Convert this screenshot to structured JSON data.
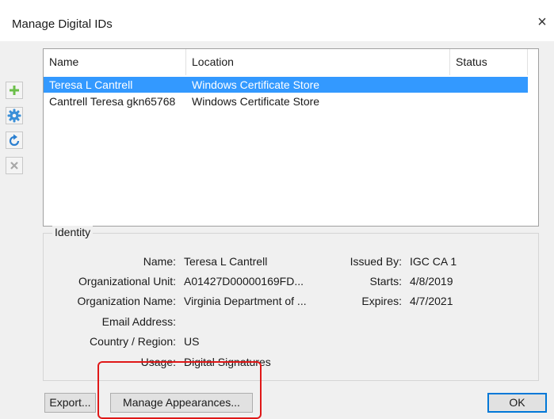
{
  "window": {
    "title": "Manage Digital IDs",
    "close_symbol": "×"
  },
  "toolbar": {
    "buttons": [
      {
        "icon": "plus-icon",
        "enabled": true
      },
      {
        "icon": "gear-icon",
        "enabled": true
      },
      {
        "icon": "refresh-icon",
        "enabled": true
      },
      {
        "icon": "delete-icon",
        "enabled": false
      }
    ]
  },
  "list": {
    "columns": [
      "Name",
      "Location",
      "Status"
    ],
    "rows": [
      {
        "name": "Teresa L Cantrell",
        "location": "Windows Certificate Store",
        "status": "",
        "selected": true
      },
      {
        "name": "Cantrell Teresa gkn65768",
        "location": "Windows Certificate Store",
        "status": "",
        "selected": false
      }
    ]
  },
  "identity": {
    "title": "Identity",
    "left": [
      {
        "label": "Name:",
        "value": "Teresa L Cantrell"
      },
      {
        "label": "Organizational Unit:",
        "value": "A01427D00000169FD..."
      },
      {
        "label": "Organization Name:",
        "value": "Virginia Department of ..."
      },
      {
        "label": "Email Address:",
        "value": ""
      },
      {
        "label": "Country / Region:",
        "value": "US"
      },
      {
        "label": "Usage:",
        "value": "Digital Signatures"
      }
    ],
    "right": [
      {
        "label": "Issued By:",
        "value": "IGC CA 1"
      },
      {
        "label": "Starts:",
        "value": "4/8/2019"
      },
      {
        "label": "Expires:",
        "value": "4/7/2021"
      }
    ]
  },
  "buttons": {
    "export": "Export...",
    "manage_appearances": "Manage Appearances...",
    "ok": "OK"
  },
  "colors": {
    "selection": "#3399ff",
    "highlight": "#e01818",
    "plus": "#6cbf4a",
    "gear": "#3a8fd8"
  }
}
